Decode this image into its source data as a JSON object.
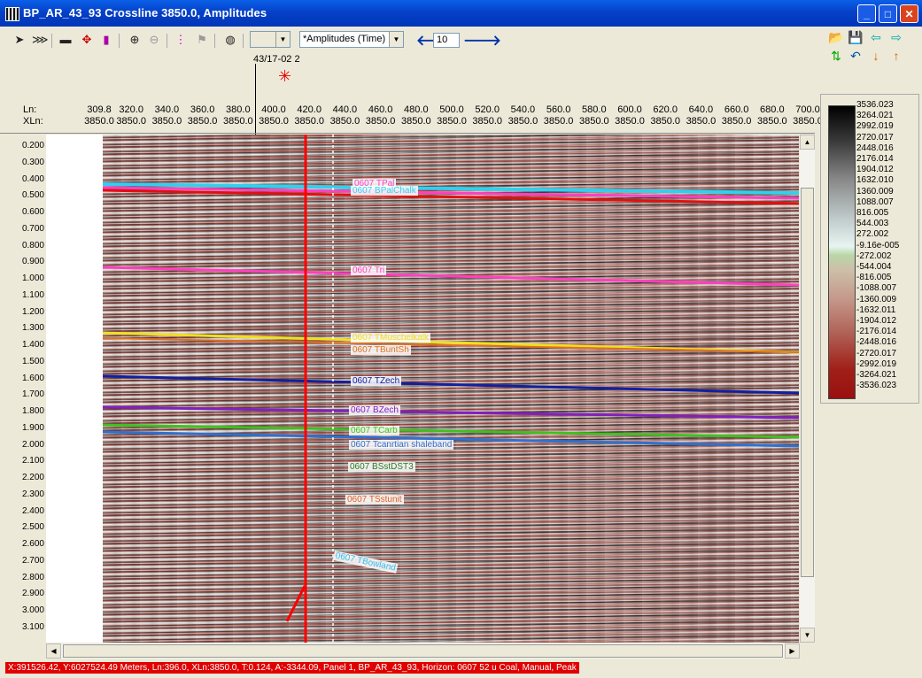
{
  "window": {
    "title": "BP_AR_43_93 Crossline 3850.0, Amplitudes",
    "min_label": "_",
    "max_label": "□",
    "close_label": "✕"
  },
  "toolbar": {
    "blank_combo": "",
    "display_combo": "*Amplitudes (Time)",
    "step_value": "10",
    "icons": [
      "pointer-icon",
      "multi-select-icon",
      "ruler-icon",
      "crossplot-icon",
      "colorbar-icon",
      "zoom-in-icon",
      "zoom-out-icon",
      "tracks-icon",
      "flag-icon",
      "globe-icon"
    ]
  },
  "right_toolbar": {
    "icons": [
      "open-folder-icon",
      "save-icon",
      "arrow-left-icon",
      "arrow-right-icon",
      "swap-icon",
      "undo-icon",
      "sort-down-icon",
      "sort-up-icon"
    ]
  },
  "well": {
    "name": "43/17-02 2"
  },
  "axis": {
    "ln_label": "Ln:",
    "xln_label": "XLn:",
    "ln_ticks": [
      "309.8",
      "320.0",
      "340.0",
      "360.0",
      "380.0",
      "400.0",
      "420.0",
      "440.0",
      "460.0",
      "480.0",
      "500.0",
      "520.0",
      "540.0",
      "560.0",
      "580.0",
      "600.0",
      "620.0",
      "640.0",
      "660.0",
      "680.0",
      "700.0"
    ],
    "xln_ticks": [
      "3850.0",
      "3850.0",
      "3850.0",
      "3850.0",
      "3850.0",
      "3850.0",
      "3850.0",
      "3850.0",
      "3850.0",
      "3850.0",
      "3850.0",
      "3850.0",
      "3850.0",
      "3850.0",
      "3850.0",
      "3850.0",
      "3850.0",
      "3850.0",
      "3850.0",
      "3850.0",
      "3850.0"
    ],
    "time_ticks": [
      "0.200",
      "0.300",
      "0.400",
      "0.500",
      "0.600",
      "0.700",
      "0.800",
      "0.900",
      "1.000",
      "1.100",
      "1.200",
      "1.300",
      "1.400",
      "1.500",
      "1.600",
      "1.700",
      "1.800",
      "1.900",
      "2.000",
      "2.100",
      "2.200",
      "2.300",
      "2.400",
      "2.500",
      "2.600",
      "2.700",
      "2.800",
      "2.900",
      "3.000",
      "3.100"
    ]
  },
  "horizons": [
    {
      "label": "0607 TPal",
      "color": "#FF40C0"
    },
    {
      "label": "0607 BPalChalk",
      "color": "#30D0F0"
    },
    {
      "label": "0607 Tri",
      "color": "#FF40C0"
    },
    {
      "label": "0607 TMuschelkalk",
      "color": "#F0E020"
    },
    {
      "label": "0607 TBuntSh",
      "color": "#E07020"
    },
    {
      "label": "0607 TZech",
      "color": "#1020A0"
    },
    {
      "label": "0607 BZech",
      "color": "#8020C0"
    },
    {
      "label": "0607 TCarb",
      "color": "#40C020"
    },
    {
      "label": "0607 Tcanrtian shaleband",
      "color": "#3070D0"
    },
    {
      "label": "0607 BSstDST3",
      "color": "#208020"
    },
    {
      "label": "0607 TSstunit",
      "color": "#E06020"
    },
    {
      "label": "0607 TBowland",
      "color": "#30C0F0"
    }
  ],
  "colorbar": {
    "labels": [
      "3536.023",
      "3264.021",
      "2992.019",
      "2720.017",
      "2448.016",
      "2176.014",
      "1904.012",
      "1632.010",
      "1360.009",
      "1088.007",
      "816.005",
      "544.003",
      "272.002",
      "-9.16e-005",
      "-272.002",
      "-544.004",
      "-816.005",
      "-1088.007",
      "-1360.009",
      "-1632.011",
      "-1904.012",
      "-2176.014",
      "-2448.016",
      "-2720.017",
      "-2992.019",
      "-3264.021",
      "-3536.023"
    ]
  },
  "status": {
    "text": "X:391526.42, Y:6027524.49 Meters,  Ln:396.0, XLn:3850.0,  T:0.124,  A:-3344.09,  Panel 1,  BP_AR_43_93,  Horizon: 0607 52 u Coal, Manual, Peak"
  }
}
